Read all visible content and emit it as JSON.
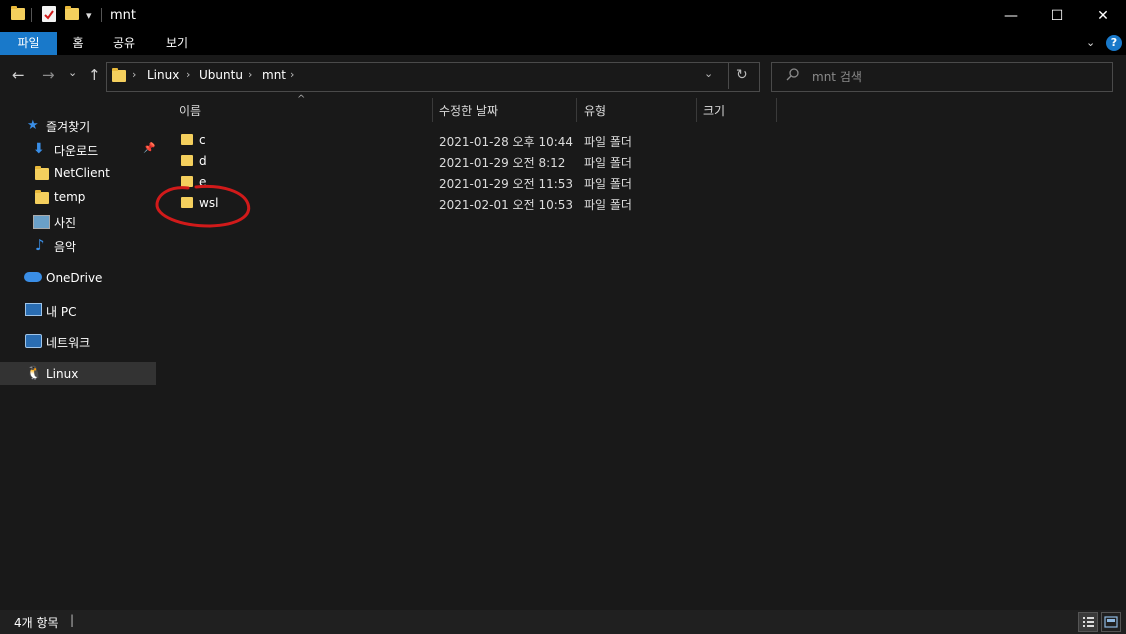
{
  "window": {
    "title": "mnt",
    "minimize": "—",
    "maximize": "☐",
    "close": "✕"
  },
  "ribbon": {
    "tabs": [
      "파일",
      "홈",
      "공유",
      "보기"
    ],
    "expand": "⌄",
    "help": "?"
  },
  "nav": {
    "back": "←",
    "forward": "→",
    "recent": "⌄",
    "up": "↑",
    "breadcrumb": [
      "Linux",
      "Ubuntu",
      "mnt"
    ],
    "crumb_sep": "›",
    "dropdown": "⌄",
    "refresh": "↻"
  },
  "search": {
    "placeholder": "mnt 검색",
    "icon": "search-icon"
  },
  "sidebar": {
    "quick_access": "즐겨찾기",
    "items": [
      {
        "label": "다운로드",
        "icon": "download-icon",
        "pinned": true
      },
      {
        "label": "NetClient",
        "icon": "folder-icon"
      },
      {
        "label": "temp",
        "icon": "folder-icon"
      },
      {
        "label": "사진",
        "icon": "pictures-icon"
      },
      {
        "label": "음악",
        "icon": "music-icon"
      }
    ],
    "onedrive": "OneDrive",
    "this_pc": "내 PC",
    "network": "네트워크",
    "linux": "Linux"
  },
  "columns": {
    "name": "이름",
    "date": "수정한 날짜",
    "type": "유형",
    "size": "크기",
    "sort_indicator": "^"
  },
  "files": [
    {
      "name": "c",
      "date": "2021-01-28 오후 10:44",
      "type": "파일 폴더"
    },
    {
      "name": "d",
      "date": "2021-01-29 오전 8:12",
      "type": "파일 폴더"
    },
    {
      "name": "e",
      "date": "2021-01-29 오전 11:53",
      "type": "파일 폴더"
    },
    {
      "name": "wsl",
      "date": "2021-02-01 오전 10:53",
      "type": "파일 폴더"
    }
  ],
  "status": {
    "count": "4개 항목",
    "divider": "|"
  },
  "colors": {
    "accent": "#1979ca",
    "folder": "#f4cf5d",
    "annotation": "#d11a1a"
  }
}
